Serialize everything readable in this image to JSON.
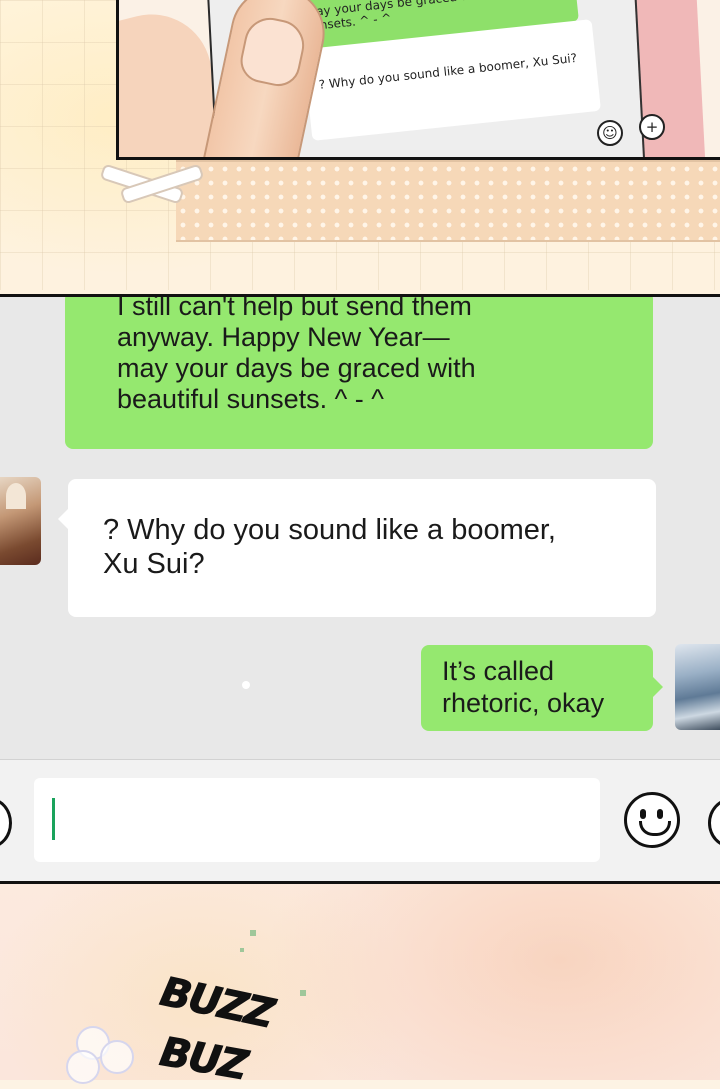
{
  "top_panel": {
    "mini_green_text": "may your days be graced with beautiful sunsets. ^ - ^",
    "mini_white_text": "? Why do you sound like a boomer, Xu Sui?",
    "emoji_glyph": "☺",
    "plus_glyph": "+"
  },
  "chat": {
    "messages": [
      {
        "side": "right",
        "text_lines": [
          "I still can't help but send them",
          "anyway. Happy New Year—",
          "may your days be graced with",
          "beautiful sunsets. ^ - ^"
        ]
      },
      {
        "side": "left",
        "text_lines": [
          "? Why do you sound like a boomer,",
          "Xu Sui?"
        ]
      },
      {
        "side": "right",
        "text_lines": [
          "It’s called",
          "rhetoric, okay"
        ]
      }
    ],
    "input": {
      "value": ""
    }
  },
  "sfx": {
    "buzz_1": "BUZZ",
    "buzz_2": "BUZ"
  },
  "colors": {
    "bubble_green": "#95e86f",
    "bubble_white": "#ffffff",
    "chat_background": "#e8e8e8",
    "cursor": "#1aa35c"
  },
  "icons": [
    "voice-icon",
    "emoji-icon",
    "plus-icon"
  ]
}
